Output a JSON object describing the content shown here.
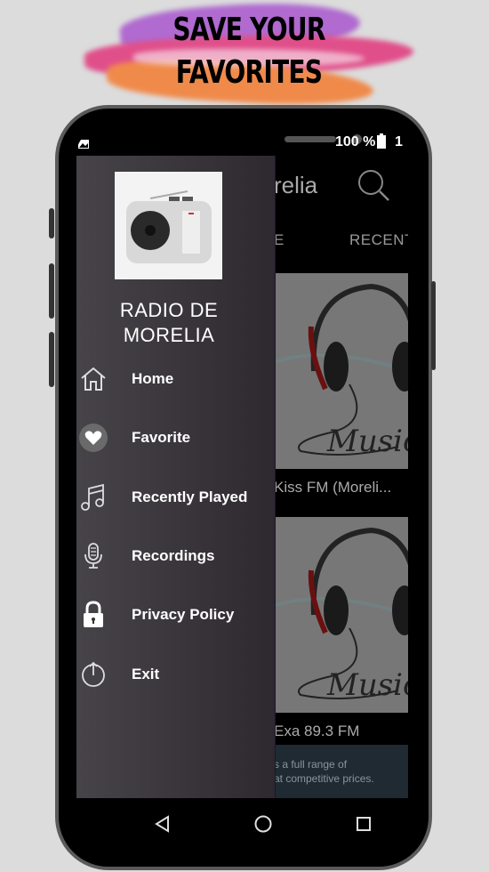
{
  "banner": {
    "line1": "SAVE YOUR",
    "line2": "FAVORITES"
  },
  "status_bar": {
    "battery": "100 %",
    "time_partial": "1"
  },
  "app": {
    "title_partial": "relia",
    "tabs": [
      {
        "label": "E"
      },
      {
        "label": "RECENT"
      }
    ],
    "stations": [
      {
        "name": "Kiss FM (Moreli...",
        "artwork": "music-headphones"
      },
      {
        "name": "Exa 89.3 FM",
        "artwork": "music-headphones"
      }
    ],
    "ad": {
      "line1": "s a full range of",
      "line2": "at competitive prices."
    }
  },
  "drawer": {
    "app_name_line1": "RADIO DE",
    "app_name_line2": "MORELIA",
    "items": [
      {
        "label": "Home",
        "icon": "home-icon"
      },
      {
        "label": "Favorite",
        "icon": "heart-icon"
      },
      {
        "label": "Recently Played",
        "icon": "music-note-icon"
      },
      {
        "label": "Recordings",
        "icon": "microphone-icon"
      },
      {
        "label": "Privacy Policy",
        "icon": "lock-icon"
      },
      {
        "label": "Exit",
        "icon": "power-icon"
      }
    ]
  },
  "navbar": {
    "back": "back",
    "home": "home",
    "recents": "recents"
  }
}
